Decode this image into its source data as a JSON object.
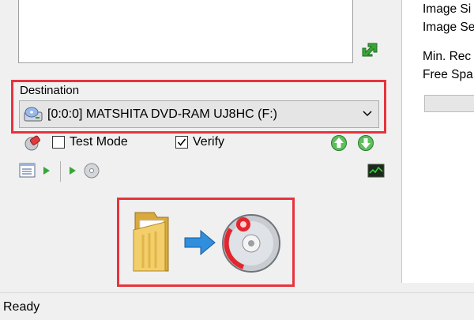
{
  "source": {
    "add_icon": "green-arrow-add-icon"
  },
  "destination": {
    "label": "Destination",
    "selected_device": "[0:0:0] MATSHITA DVD-RAM UJ8HC (F:)",
    "device_icon": "optical-drive-icon",
    "dropdown_icon": "chevron-down-icon"
  },
  "options": {
    "erase_icon": "eraser-icon",
    "test_mode": {
      "label": "Test Mode",
      "checked": false
    },
    "verify": {
      "label": "Verify",
      "checked": true
    },
    "move_up_icon": "green-up-arrow-icon",
    "move_down_icon": "green-down-arrow-icon"
  },
  "toolbar": {
    "icons": [
      "file-list-icon",
      "play-small-icon",
      "play-small-icon",
      "disc-small-icon",
      "log-window-icon"
    ]
  },
  "action": {
    "icons": [
      "folder-icon",
      "blue-right-arrow-icon",
      "burn-disc-icon"
    ]
  },
  "info_panel": {
    "image_size_label": "Image Si",
    "image_sectors_label": "Image Se",
    "min_required_label": "Min. Rec",
    "free_space_label": "Free Spa"
  },
  "status": {
    "text": "Ready"
  },
  "colors": {
    "highlight": "#e8333b",
    "accent_green": "#3aa33a",
    "accent_blue": "#2f8fdc"
  }
}
